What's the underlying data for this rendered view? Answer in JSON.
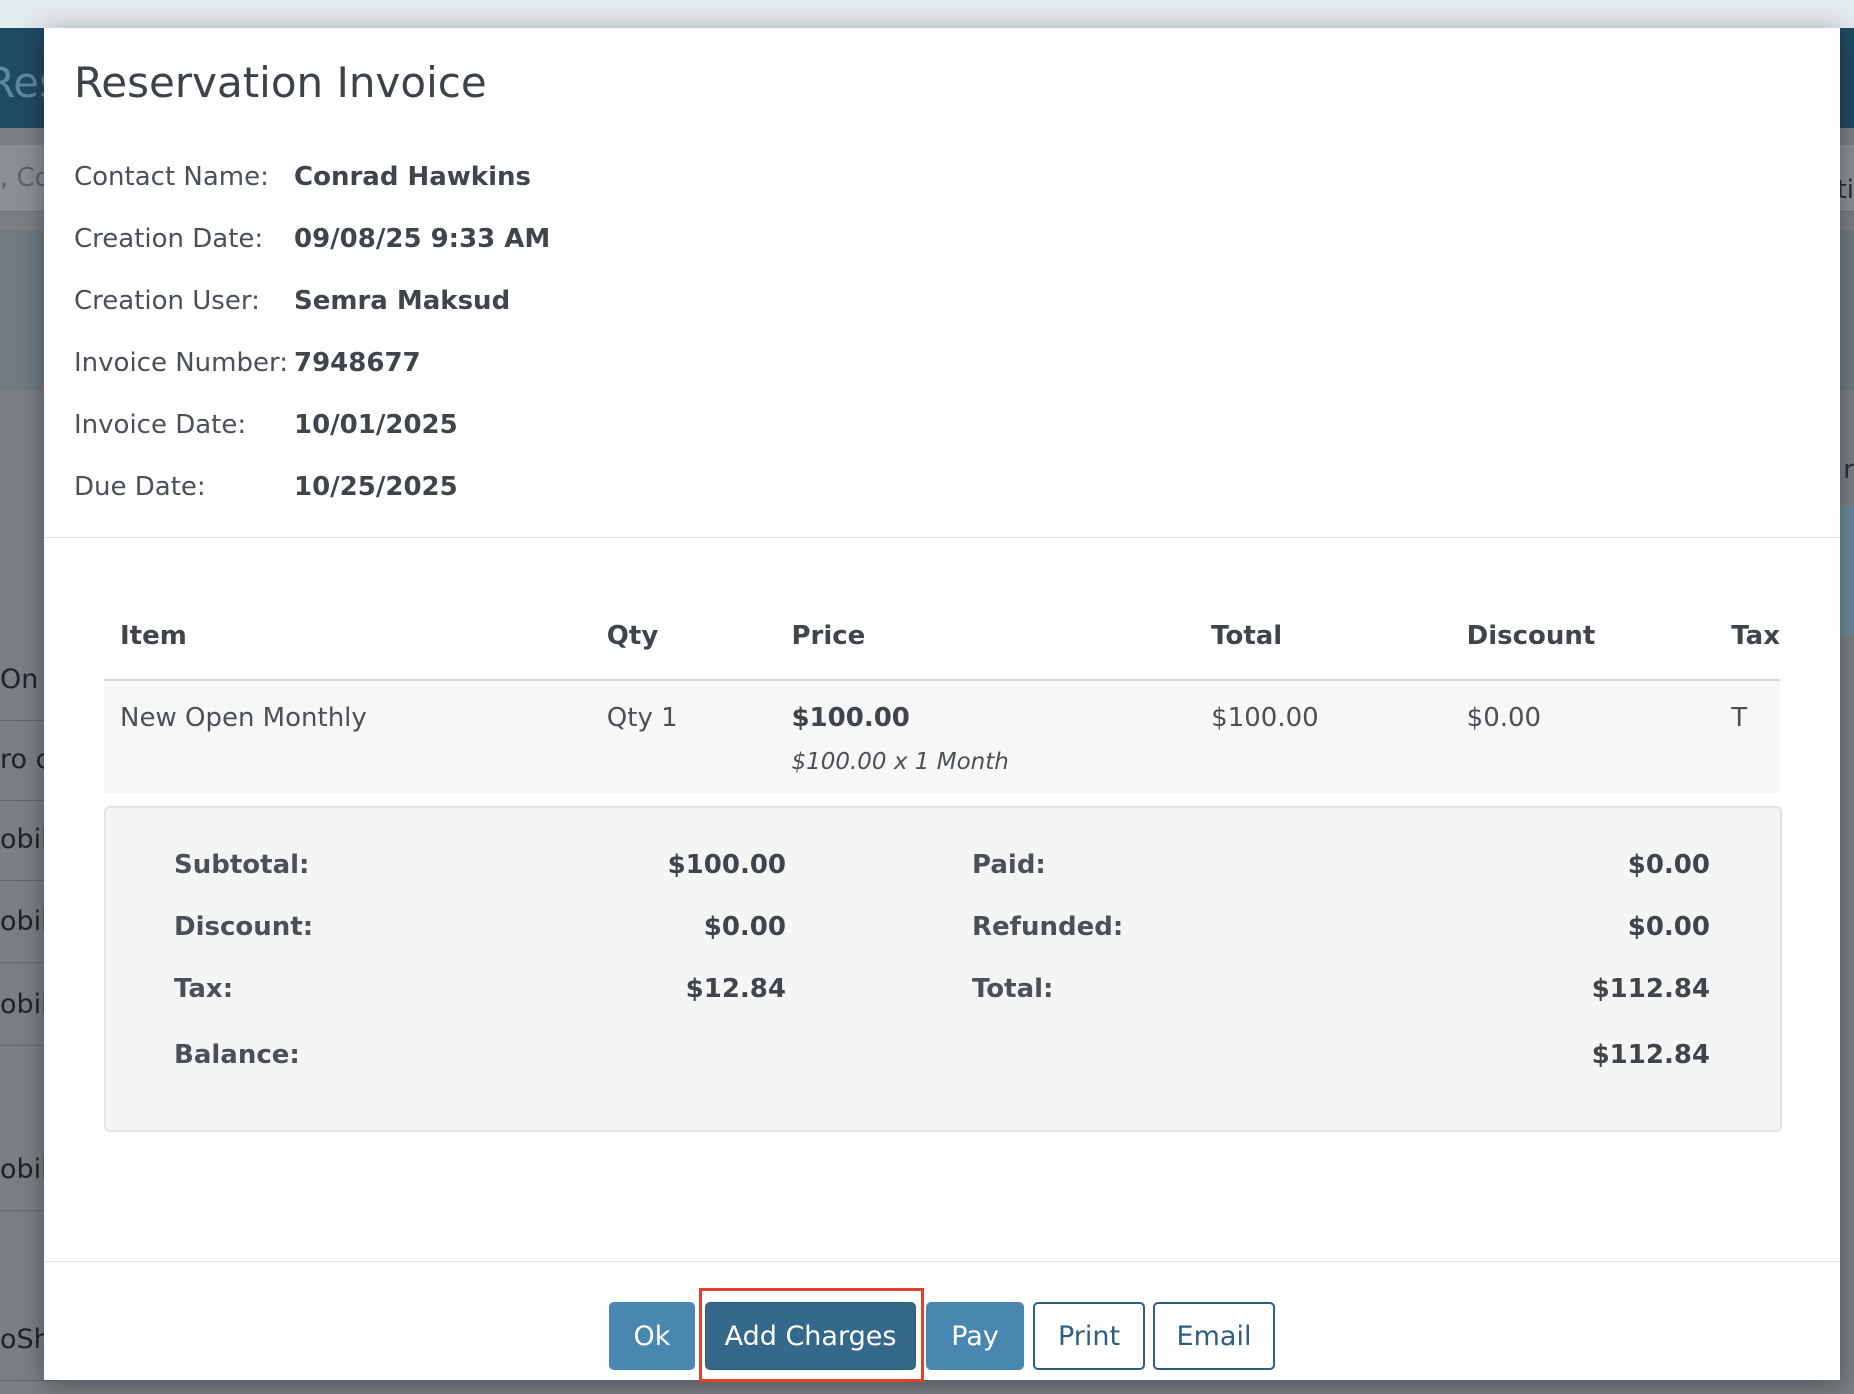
{
  "background": {
    "header_title": "Res",
    "search_fragment": ", Co",
    "rows": [
      "On L",
      "ro c",
      "obil",
      "obil",
      "obil",
      "obil",
      "oSh"
    ],
    "right_fragments": [
      "ti",
      "r",
      "."
    ]
  },
  "modal": {
    "title": "Reservation Invoice",
    "info": [
      {
        "label": "Contact Name:",
        "value": "Conrad Hawkins"
      },
      {
        "label": "Creation Date:",
        "value": "09/08/25 9:33 AM"
      },
      {
        "label": "Creation User:",
        "value": "Semra Maksud"
      },
      {
        "label": "Invoice Number:",
        "value": "7948677"
      },
      {
        "label": "Invoice Date:",
        "value": "10/01/2025"
      },
      {
        "label": "Due Date:",
        "value": "10/25/2025"
      }
    ],
    "table": {
      "columns": [
        "Item",
        "Qty",
        "Price",
        "Total",
        "Discount",
        "Tax"
      ],
      "rows": [
        {
          "item": "New Open Monthly",
          "qty": "Qty 1",
          "price": "$100.00",
          "price_detail": "$100.00 x 1 Month",
          "total": "$100.00",
          "discount": "$0.00",
          "tax": "T"
        }
      ]
    },
    "totals": {
      "subtotal_label": "Subtotal:",
      "subtotal": "$100.00",
      "discount_label": "Discount:",
      "discount": "$0.00",
      "tax_label": "Tax:",
      "tax": "$12.84",
      "balance_label": "Balance:",
      "balance": "$112.84",
      "paid_label": "Paid:",
      "paid": "$0.00",
      "refunded_label": "Refunded:",
      "refunded": "$0.00",
      "total_label": "Total:",
      "total": "$112.84"
    },
    "buttons": {
      "ok": "Ok",
      "add_charges": "Add Charges",
      "pay": "Pay",
      "print": "Print",
      "email": "Email"
    }
  },
  "colors": {
    "primary": "#4a87b0",
    "primary_dark": "#35698c",
    "highlight": "#e2412a"
  }
}
